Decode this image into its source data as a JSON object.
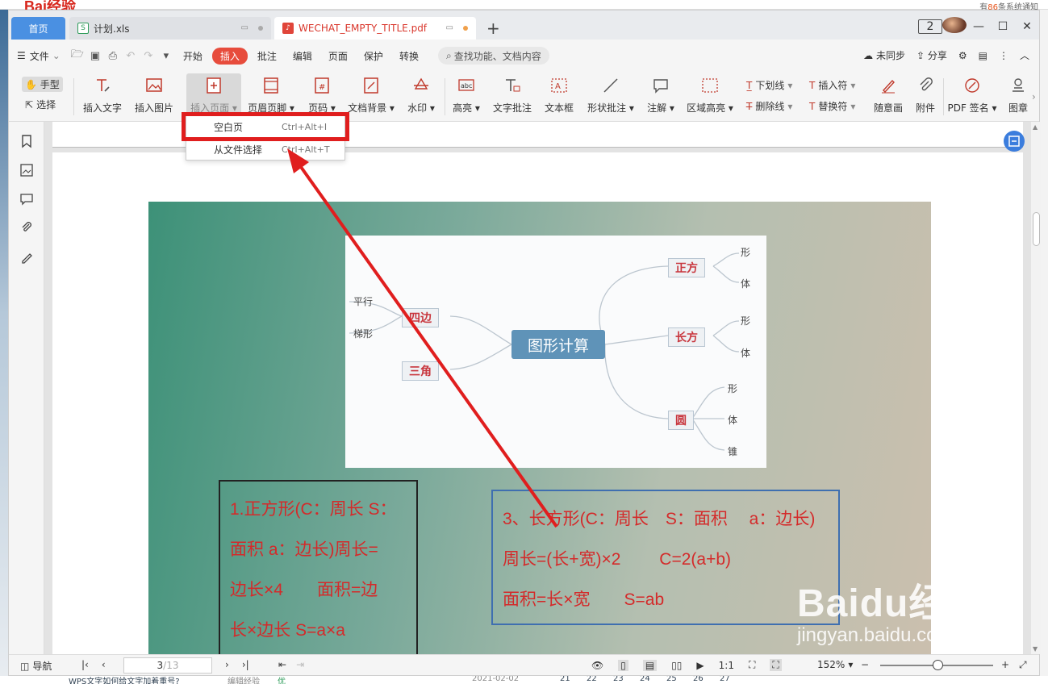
{
  "background": {
    "logo": "Bai经验",
    "notice_prefix": "有",
    "notice_count": "86",
    "notice_suffix": "条系统通知",
    "bottom_link": "WPS文字如何给文字加着重号?",
    "bottom_tag1": "编辑经验",
    "bottom_tag2": "优",
    "bottom_date": "2021-02-02",
    "bottom_days": [
      "21",
      "22",
      "23",
      "24",
      "25",
      "26",
      "27"
    ]
  },
  "tabs": {
    "home": "首页",
    "xls": "计划.xls",
    "pdf": "WECHAT_EMPTY_TITLE.pdf",
    "badge": "2"
  },
  "menubar": {
    "file": "文件",
    "items": [
      "开始",
      "插入",
      "批注",
      "编辑",
      "页面",
      "保护",
      "转换"
    ],
    "active": "插入",
    "search": "查找功能、文档内容",
    "sync": "未同步",
    "share": "分享"
  },
  "ribbon": {
    "hand": "手型",
    "select": "选择",
    "insert_text": "插入文字",
    "insert_image": "插入图片",
    "insert_page": "插入页面",
    "header_footer": "页眉页脚",
    "page_number": "页码",
    "doc_bg": "文档背景",
    "watermark": "水印",
    "highlight": "高亮",
    "text_comment": "文字批注",
    "text_box": "文本框",
    "shape_comment": "形状批注",
    "annotation": "注解",
    "area_highlight": "区域高亮",
    "underline": "下划线",
    "strikethrough": "删除线",
    "insert_symbol": "插入符",
    "replace_symbol": "替换符",
    "freehand": "随意画",
    "attachment": "附件",
    "pdf_sign": "PDF 签名",
    "stamp": "图章"
  },
  "dropdown": {
    "items": [
      {
        "label": "空白页",
        "shortcut": "Ctrl+Alt+I"
      },
      {
        "label": "从文件选择",
        "shortcut": "Ctrl+Alt+T"
      }
    ]
  },
  "document": {
    "mind_center": "图形计算",
    "node_square": "正方",
    "node_rect": "长方",
    "node_circle": "圆",
    "node_quad": "四边",
    "node_tri": "三角",
    "leaf_xing": "形",
    "leaf_ti": "体",
    "leaf_zhui": "锥",
    "leaf_parallel": "平行",
    "leaf_trapezoid": "梯形",
    "box1_lines": [
      "1.正方形(C：周长 S：",
      "面积 a：边长)周长=",
      "边长×4　　面积=边",
      "长×边长 S=a×a"
    ],
    "box2_lines": [
      "3、长方形(C：周长　S：面积　 a：边长)",
      "周长=(长+宽)×2　　 C=2(a+b)",
      "面积=长×宽　　S=ab"
    ],
    "watermark_main": "Baidu经验",
    "watermark_sub": "jingyan.baidu.com"
  },
  "statusbar": {
    "nav": "导航",
    "page_current": "3",
    "page_total": "/13",
    "zoom": "152%"
  },
  "colors": {
    "accent_red": "#e74c3c",
    "tab_blue": "#4a90e2",
    "highlight_red": "#e01e1e"
  }
}
